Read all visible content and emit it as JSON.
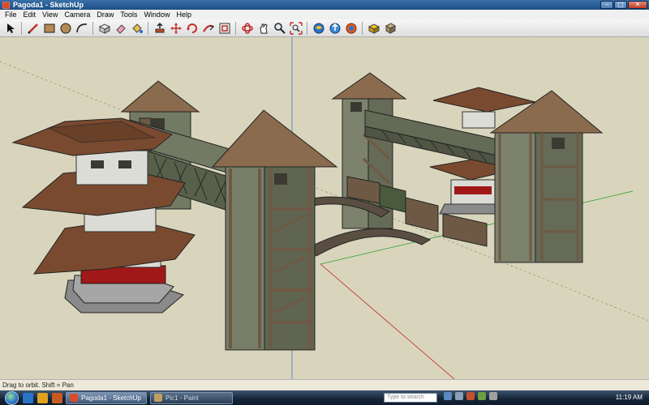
{
  "window": {
    "title": "Pagoda1 - SketchUp"
  },
  "menu": [
    "File",
    "Edit",
    "View",
    "Camera",
    "Draw",
    "Tools",
    "Window",
    "Help"
  ],
  "toolbar": {
    "tools": [
      "select-icon",
      "pencil-line-icon",
      "rectangle-icon",
      "circle-icon",
      "arc-icon",
      "make-component-icon",
      "eraser-icon",
      "paint-bucket-icon",
      "push-pull-icon",
      "move-icon",
      "rotate-icon",
      "follow-me-icon",
      "offset-icon",
      "orbit-icon",
      "pan-icon",
      "zoom-icon",
      "zoom-extents-icon",
      "get-models-icon",
      "share-model-icon",
      "photo-textures-icon",
      "share-component-icon",
      "google-earth-icon"
    ]
  },
  "status": {
    "text": "Drag to orbit.  Shift = Pan"
  },
  "taskbar": {
    "tasks": [
      {
        "label": "Pagoda1 - SketchUp",
        "active": true
      },
      {
        "label": "Pic1 - Paint",
        "active": false
      }
    ],
    "search_placeholder": "Type to search",
    "clock": "11:19 AM"
  },
  "colors": {
    "viewport_bg": "#d9d5bd",
    "roof": "#8b6b4e",
    "roof_red": "#7a4a30",
    "wood": "#6e5a44",
    "wall_green": "#7c826c",
    "wall_white": "#dcdcd6",
    "red_band": "#a01818",
    "stone": "#8a8a8a"
  }
}
